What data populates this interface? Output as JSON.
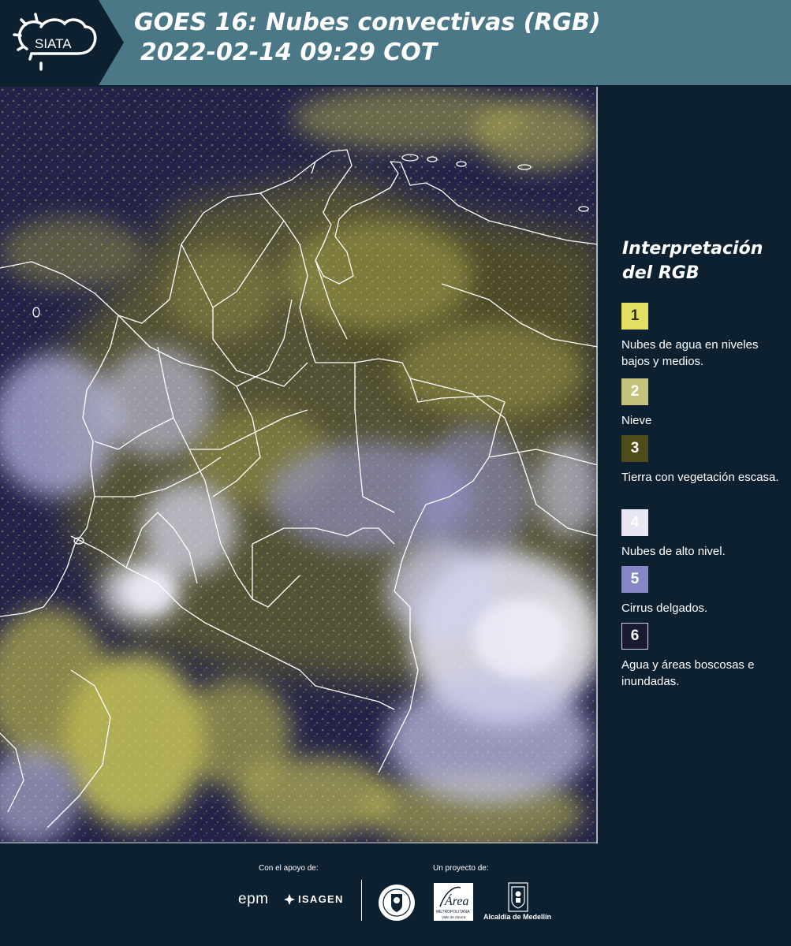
{
  "header": {
    "logo_text": "SIATA",
    "title_line1": "GOES 16: Nubes convectivas (RGB)",
    "title_line2": "2022-02-14 09:29 COT",
    "background_color": "#4b7887",
    "logo_panel_color": "#0d2030"
  },
  "map": {
    "alt": "GOES 16 RGB satellite image over Colombia"
  },
  "legend": {
    "title_line1": "Interpretación",
    "title_line2": "del RGB",
    "items": [
      {
        "number": "1",
        "label": "Nubes de agua en niveles bajos y medios.",
        "color": "#e2df63",
        "text_color": "#2e2d10"
      },
      {
        "number": "2",
        "label": "Nieve",
        "color": "#c5c27c",
        "text_color": "#ffffff"
      },
      {
        "number": "3",
        "label": "Tierra con vegetación escasa.",
        "color": "#4e4c1a",
        "text_color": "#ffffff"
      },
      {
        "number": "4",
        "label": "Nubes de alto nivel.",
        "color": "#e6e6f4",
        "text_color": "#ffffff"
      },
      {
        "number": "5",
        "label": "Cirrus delgados.",
        "color": "#8787c6",
        "text_color": "#ffffff"
      },
      {
        "number": "6",
        "label": "Agua y áreas boscosas e inundadas.",
        "color": "#1a1a33",
        "text_color": "#ffffff"
      }
    ]
  },
  "footer": {
    "support_label": "Con el apoyo de:",
    "project_label": "Un proyecto de:",
    "sponsors": [
      "epm",
      "ISAGEN"
    ],
    "partners": {
      "area_logo_text": "Área",
      "area_logo_subtext": "METROPOLITANA Valle de Aburrá",
      "alcaldia": "Alcaldía de Medellín"
    }
  }
}
